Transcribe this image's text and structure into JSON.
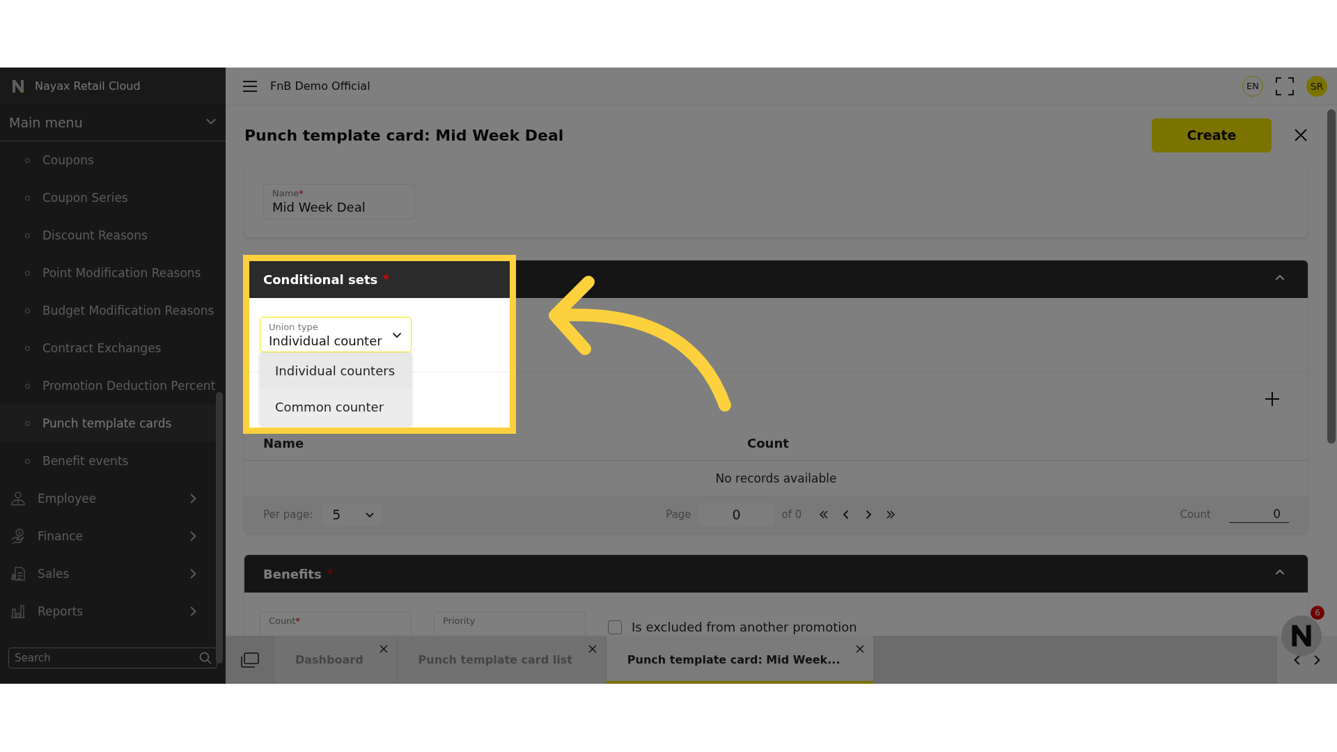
{
  "app": {
    "name": "Nayax Retail Cloud"
  },
  "sidebar": {
    "section": "Main menu",
    "expanded": true,
    "items": [
      {
        "label": "Coupons",
        "selected": false
      },
      {
        "label": "Coupon Series",
        "selected": false
      },
      {
        "label": "Discount Reasons",
        "selected": false
      },
      {
        "label": "Point Modification Reasons",
        "selected": false
      },
      {
        "label": "Budget Modification Reasons",
        "selected": false
      },
      {
        "label": "Contract Exchanges",
        "selected": false
      },
      {
        "label": "Promotion Deduction Percent",
        "selected": false
      },
      {
        "label": "Punch template cards",
        "selected": true
      },
      {
        "label": "Benefit events",
        "selected": false
      }
    ],
    "groups": [
      {
        "label": "Employee",
        "kind": "employee",
        "expanded": false
      },
      {
        "label": "Finance",
        "kind": "finance",
        "expanded": false
      },
      {
        "label": "Sales",
        "kind": "sales",
        "expanded": false
      },
      {
        "label": "Reports",
        "kind": "reports",
        "expanded": false
      }
    ],
    "search": {
      "placeholder": "Search"
    }
  },
  "topbar": {
    "account": "FnB Demo Official",
    "language": "EN",
    "user_initials": "SR"
  },
  "page": {
    "title": "Punch template card: Mid Week Deal",
    "create_button": "Create",
    "name_field": {
      "label": "Name",
      "required_mark": "*",
      "value": "Mid Week Deal"
    }
  },
  "conditional_sets": {
    "title": "Conditional sets",
    "required_mark": "*",
    "expanded": true,
    "union_type": {
      "label": "Union type",
      "value": "Individual counter",
      "open": true,
      "options": [
        {
          "label": "Individual counters",
          "selected": true
        },
        {
          "label": "Common counter",
          "selected": false
        }
      ]
    },
    "table": {
      "columns": [
        "Name",
        "Count"
      ],
      "empty_text": "No records available"
    },
    "pagination": {
      "per_page_label": "Per page:",
      "per_page": "5",
      "page_label": "Page",
      "page": "0",
      "of_text": "of 0",
      "count_label": "Count",
      "count": "0"
    }
  },
  "benefits": {
    "title": "Benefits",
    "required_mark": "*",
    "expanded": true,
    "fields": [
      {
        "label": "Count",
        "required_mark": "*"
      },
      {
        "label": "Priority"
      }
    ],
    "excluded": {
      "label": "Is excluded from another promotion",
      "checked": false
    }
  },
  "tabs": [
    {
      "label": "Dashboard",
      "selected": false
    },
    {
      "label": "Punch template card list",
      "selected": false
    },
    {
      "label": "Punch template card: Mid Week...",
      "selected": true
    }
  ],
  "assistant": {
    "badge": "6"
  }
}
